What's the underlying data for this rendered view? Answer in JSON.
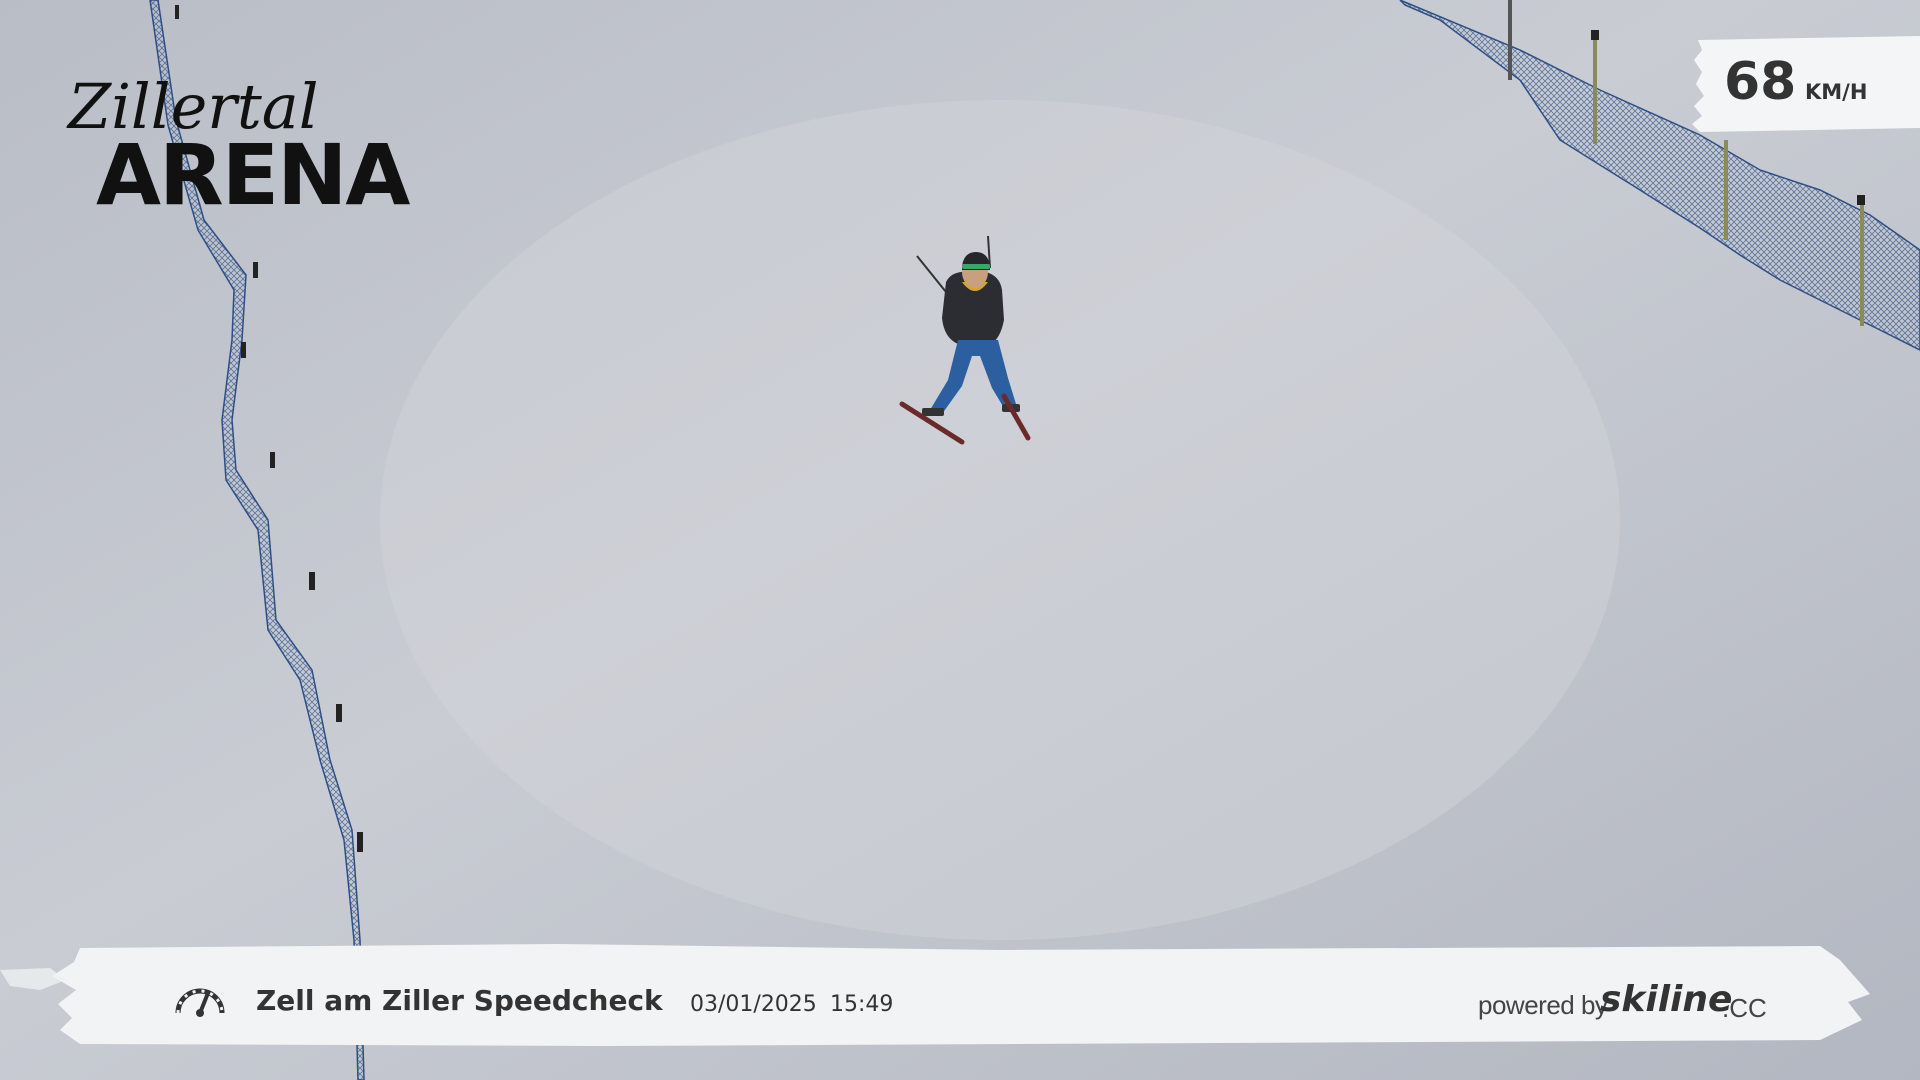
{
  "overlay": {
    "brand": {
      "script_text": "Zillertal",
      "block_text": "ARENA"
    },
    "speed": {
      "value": "68",
      "unit": "KM/H"
    },
    "bottom_bar": {
      "title": "Zell am Ziller Speedcheck",
      "date": "03/01/2025",
      "time": "15:49",
      "powered_by_label": "powered by",
      "brand_name": "skiline",
      "brand_tld": ".CC",
      "icon": "speedometer-icon"
    }
  },
  "colors": {
    "snow": "#c6c9d0",
    "net": "#2e4f86",
    "jacket": "#2c2d33",
    "pants": "#2b5fa0",
    "helmet_band": "#3aa86b",
    "banner": "#f1f2f3",
    "text": "#333333"
  }
}
